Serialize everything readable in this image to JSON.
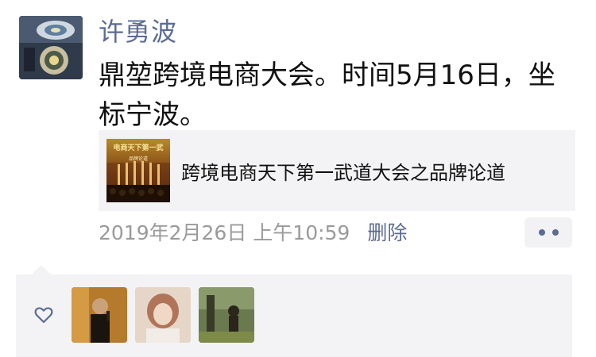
{
  "author": {
    "name": "许勇波"
  },
  "post": {
    "text": "鼎堃跨境电商大会。时间5月16日，坐标宁波。"
  },
  "link_card": {
    "thumbnail_title": "电商天下第一武",
    "thumbnail_subtitle": "品牌论道",
    "title": "跨境电商天下第一武道大会之品牌论道"
  },
  "meta": {
    "timestamp": "2019年2月26日 上午10:59",
    "delete_label": "删除"
  },
  "likes": {
    "icon": "heart-icon",
    "liker_count": 3
  },
  "colors": {
    "name_blue": "#5b6b92",
    "panel_gray": "#f3f3f5",
    "meta_gray": "#9a9a9a"
  }
}
